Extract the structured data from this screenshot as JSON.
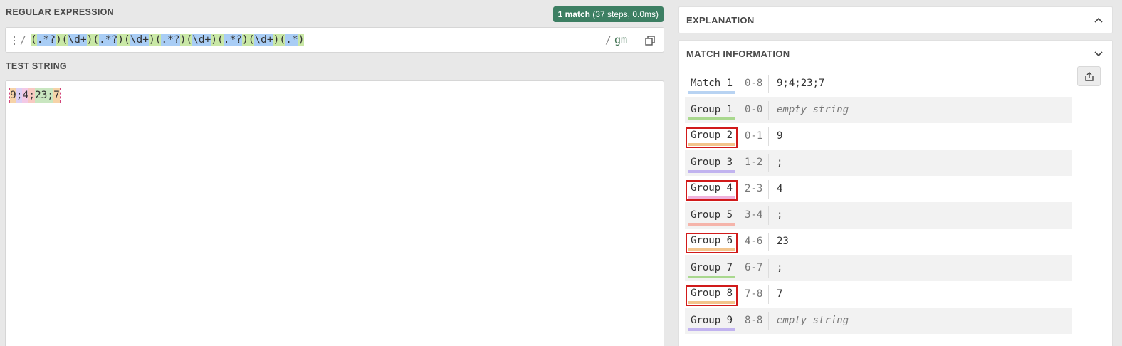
{
  "regex": {
    "section_label": "REGULAR EXPRESSION",
    "match_badge": {
      "count": "1 match",
      "detail": "(37 steps, 0.0ms)"
    },
    "delim_open": "/",
    "delim_close": "/",
    "flags": "gm",
    "pattern_tokens": [
      {
        "t": "(",
        "k": "paren"
      },
      {
        "t": ".*?",
        "k": "body"
      },
      {
        "t": ")",
        "k": "paren"
      },
      {
        "t": "(",
        "k": "paren"
      },
      {
        "t": "\\d+",
        "k": "body"
      },
      {
        "t": ")",
        "k": "paren"
      },
      {
        "t": "(",
        "k": "paren"
      },
      {
        "t": ".*?",
        "k": "body"
      },
      {
        "t": ")",
        "k": "paren"
      },
      {
        "t": "(",
        "k": "paren"
      },
      {
        "t": "\\d+",
        "k": "body"
      },
      {
        "t": ")",
        "k": "paren"
      },
      {
        "t": "(",
        "k": "paren"
      },
      {
        "t": ".*?",
        "k": "body"
      },
      {
        "t": ")",
        "k": "paren"
      },
      {
        "t": "(",
        "k": "paren"
      },
      {
        "t": "\\d+",
        "k": "body"
      },
      {
        "t": ")",
        "k": "paren"
      },
      {
        "t": "(",
        "k": "paren"
      },
      {
        "t": ".*?",
        "k": "body"
      },
      {
        "t": ")",
        "k": "paren"
      },
      {
        "t": "(",
        "k": "paren"
      },
      {
        "t": "\\d+",
        "k": "body"
      },
      {
        "t": ")",
        "k": "paren"
      },
      {
        "t": "(",
        "k": "paren"
      },
      {
        "t": ".*",
        "k": "body"
      },
      {
        "t": ")",
        "k": "paren"
      }
    ],
    "icons": {
      "drag_handle": "drag-handle-icon",
      "copy": "copy-icon"
    }
  },
  "test_string": {
    "section_label": "TEST STRING",
    "segments": [
      {
        "t": "9",
        "color": "#f6d3a8"
      },
      {
        "t": ";",
        "color": "#dcd0f5"
      },
      {
        "t": "4",
        "color": "#f3c9e6"
      },
      {
        "t": ";",
        "color": "#f8c9c2"
      },
      {
        "t": "23",
        "color": "#c9e6c0"
      },
      {
        "t": ";",
        "color": "#c9e6c0"
      },
      {
        "t": "7",
        "color": "#f6d3a8"
      }
    ]
  },
  "explanation": {
    "title": "EXPLANATION",
    "icon": "chevron-up-icon"
  },
  "match_info": {
    "title": "MATCH INFORMATION",
    "icons": {
      "collapse": "chevron-down-icon",
      "share": "share-icon"
    },
    "rows": [
      {
        "name": "Match 1",
        "range": "0-8",
        "value": "9;4;23;7",
        "color": "#b8d3f2",
        "empty": false,
        "boxed": false
      },
      {
        "name": "Group 1",
        "range": "0-0",
        "value": "empty string",
        "color": "#a9d88e",
        "empty": true,
        "boxed": false
      },
      {
        "name": "Group 2",
        "range": "0-1",
        "value": "9",
        "color": "#f2c48c",
        "empty": false,
        "boxed": true
      },
      {
        "name": "Group 3",
        "range": "1-2",
        "value": ";",
        "color": "#c1b3ef",
        "empty": false,
        "boxed": false
      },
      {
        "name": "Group 4",
        "range": "2-3",
        "value": "4",
        "color": "#efb3dc",
        "empty": false,
        "boxed": true
      },
      {
        "name": "Group 5",
        "range": "3-4",
        "value": ";",
        "color": "#f5b4aa",
        "empty": false,
        "boxed": false
      },
      {
        "name": "Group 6",
        "range": "4-6",
        "value": "23",
        "color": "#f2c48c",
        "empty": false,
        "boxed": true
      },
      {
        "name": "Group 7",
        "range": "6-7",
        "value": ";",
        "color": "#a9d88e",
        "empty": false,
        "boxed": false
      },
      {
        "name": "Group 8",
        "range": "7-8",
        "value": "7",
        "color": "#f2c48c",
        "empty": false,
        "boxed": true
      },
      {
        "name": "Group 9",
        "range": "8-8",
        "value": "empty string",
        "color": "#c1b3ef",
        "empty": true,
        "boxed": false
      }
    ]
  }
}
